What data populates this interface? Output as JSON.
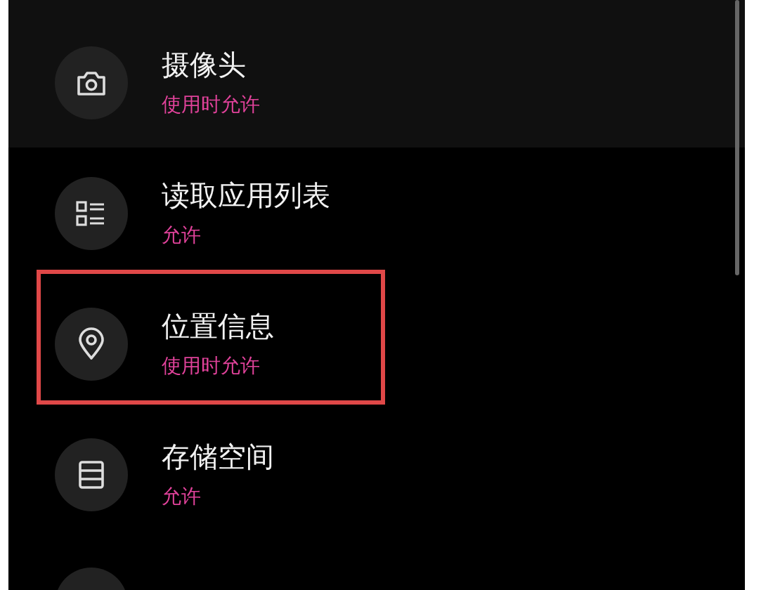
{
  "permissions": [
    {
      "title": "摄像头",
      "status": "使用时允许",
      "selected": true,
      "boxed": false
    },
    {
      "title": "读取应用列表",
      "status": "允许",
      "selected": false,
      "boxed": false
    },
    {
      "title": "位置信息",
      "status": "使用时允许",
      "selected": false,
      "boxed": true
    },
    {
      "title": "存储空间",
      "status": "允许",
      "selected": false,
      "boxed": false
    }
  ]
}
